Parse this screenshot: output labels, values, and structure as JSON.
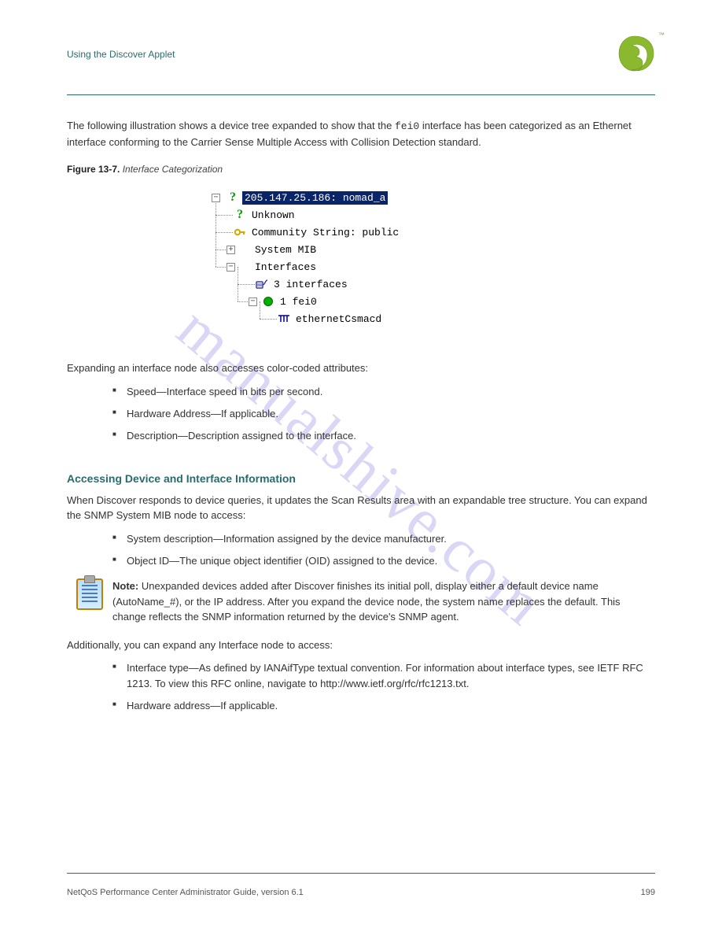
{
  "header": {
    "title": "Using the Discover Applet",
    "tm": "™"
  },
  "watermark": "manualshive.com",
  "body": {
    "intro1": "The following illustration shows a device tree expanded to show that the ",
    "intro_code": "fei0",
    "intro2": " interface has been categorized as an Ethernet interface conforming to the Carrier Sense Multiple Access with Collision Detection standard.",
    "figure_num": "Figure 13-7.",
    "figure_title": "Interface Categorization",
    "after_figure": "Expanding an interface node also accesses color-coded attributes:",
    "bullets1": [
      "Speed—Interface speed in bits per second.",
      "Hardware Address—If applicable.",
      "Description—Description assigned to the interface."
    ],
    "subhead": "Accessing Device and Interface Information",
    "accessing_intro": "When Discover responds to device queries, it updates the Scan Results area with an expandable tree structure. You can expand the SNMP System MIB node to access:",
    "bullets2": [
      "System description—Information assigned by the device manufacturer.",
      "Object ID—The unique object identifier (OID) assigned to the device."
    ],
    "note": {
      "label": "Note:",
      "body": "Unexpanded devices added after Discover finishes its initial poll, display either a default device name (AutoName_#), or the IP address. After you expand the device node, the system name replaces the default. This change reflects the SNMP information returned by the device's SNMP agent."
    },
    "accessing_para2": "Additionally, you can expand any Interface node to access:",
    "bullets3": [
      "Interface type—As defined by IANAifType textual convention. For information about interface types, see IETF RFC 1213. To view this RFC online, navigate to http://www.ietf.org/rfc/rfc1213.txt.",
      "Hardware address—If applicable."
    ]
  },
  "tree": {
    "root": {
      "expand": "−",
      "label": "205.147.25.186: nomad_a"
    },
    "unknown": "Unknown",
    "community": "Community String: public",
    "systemmib": {
      "expand": "+",
      "label": "System MIB"
    },
    "interfaces": {
      "expand": "−",
      "label": "Interfaces"
    },
    "if_count": "3 interfaces",
    "fei0": {
      "expand": "−",
      "label": "1   fei0"
    },
    "ethernet": "ethernetCsmacd"
  },
  "footer": {
    "left": "NetQoS Performance Center Administrator Guide, version 6.1",
    "right": "199"
  }
}
